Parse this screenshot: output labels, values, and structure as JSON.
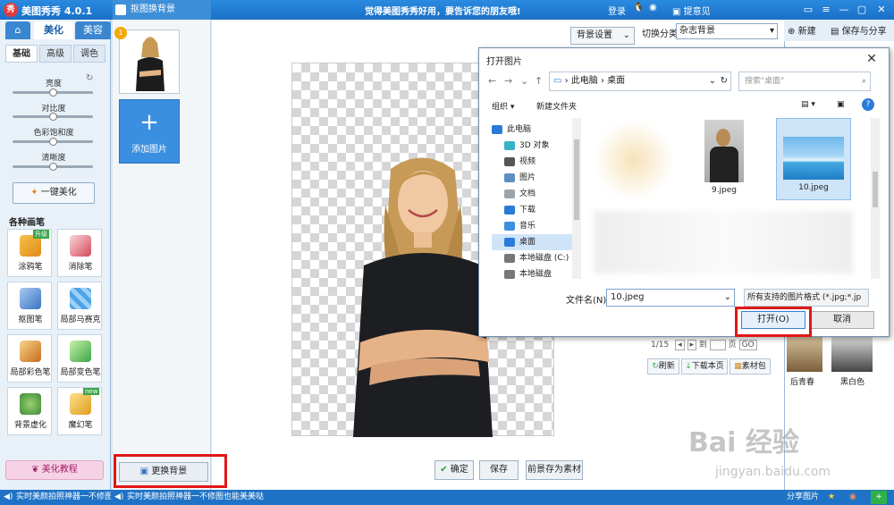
{
  "titlebar": {
    "logo": "秀",
    "app_title": "美图秀秀 4.0.1",
    "slogan": "觉得美图秀秀好用，要告诉您的朋友哦!",
    "login": "登录",
    "feedback": "提意见"
  },
  "left_panel": {
    "top_tabs": [
      "美化",
      "美容"
    ],
    "sub_tabs": [
      "基础",
      "高级",
      "调色"
    ],
    "sliders": [
      {
        "label": "亮度",
        "value": 0.5
      },
      {
        "label": "对比度",
        "value": 0.5
      },
      {
        "label": "色彩饱和度",
        "value": 0.5
      },
      {
        "label": "清晰度",
        "value": 0.5
      }
    ],
    "one_key": "一键美化",
    "section_title": "各种画笔",
    "tools": [
      {
        "label": "涂鸦笔",
        "icon": "pencil-icon",
        "badge": "升级"
      },
      {
        "label": "消除笔",
        "icon": "eraser-icon",
        "badge": ""
      },
      {
        "label": "抠图笔",
        "icon": "cutout-pen-icon",
        "badge": ""
      },
      {
        "label": "局部马赛克",
        "icon": "mosaic-icon",
        "badge": ""
      },
      {
        "label": "局部彩色笔",
        "icon": "color-brush-icon",
        "badge": ""
      },
      {
        "label": "局部变色笔",
        "icon": "paint-bucket-icon",
        "badge": ""
      },
      {
        "label": "背景虚化",
        "icon": "blur-icon",
        "badge": ""
      },
      {
        "label": "魔幻笔",
        "icon": "magic-wand-icon",
        "badge": "new"
      }
    ],
    "tutorial": "美化教程"
  },
  "cutout": {
    "header": "抠图换背景",
    "thumb_badge": "1",
    "add_image": "添加图片",
    "replace_bg": "更换背景"
  },
  "canvas": {
    "bg_settings": "背景设置",
    "category_label": "切换分类",
    "category_value": "杂志背景",
    "confirm": "确定",
    "save": "保存",
    "save_as_material": "前景存为素材"
  },
  "right_panel": {
    "new": "新建",
    "save_share": "保存与分享",
    "pager_text": "1/15",
    "pager_go_label": "到",
    "pager_unit": "页",
    "pager_go": "GO",
    "refresh": "刷新",
    "download_page": "下载本页",
    "material_pack": "素材包",
    "effects": [
      "后青春",
      "黑白色"
    ],
    "share": "分享图片"
  },
  "status": {
    "left": "实时美颜拍照神器一不修图",
    "center": "实时美颜拍照神器一不修图也能美美哒"
  },
  "dialog": {
    "title": "打开图片",
    "address": [
      "此电脑",
      "桌面"
    ],
    "search_placeholder": "搜索\"桌面\"",
    "organize": "组织",
    "new_folder": "新建文件夹",
    "tree": [
      "此电脑",
      "3D 对象",
      "视频",
      "图片",
      "文档",
      "下载",
      "音乐",
      "桌面",
      "本地磁盘 (C:)",
      "本地磁盘"
    ],
    "selected_tree": "桌面",
    "files": [
      "9.jpeg",
      "10.jpeg"
    ],
    "filename_label": "文件名(N):",
    "filename_value": "10.jpeg",
    "filter": "所有支持的图片格式 (*.jpg;*.jp",
    "open": "打开(O)",
    "cancel": "取消"
  },
  "watermark": {
    "main": "Bai 经验",
    "sub": "jingyan.baidu.com"
  },
  "colors": {
    "accent": "#1a6fc6",
    "highlight": "#e01717",
    "primary_button": "#3b8fe0"
  }
}
